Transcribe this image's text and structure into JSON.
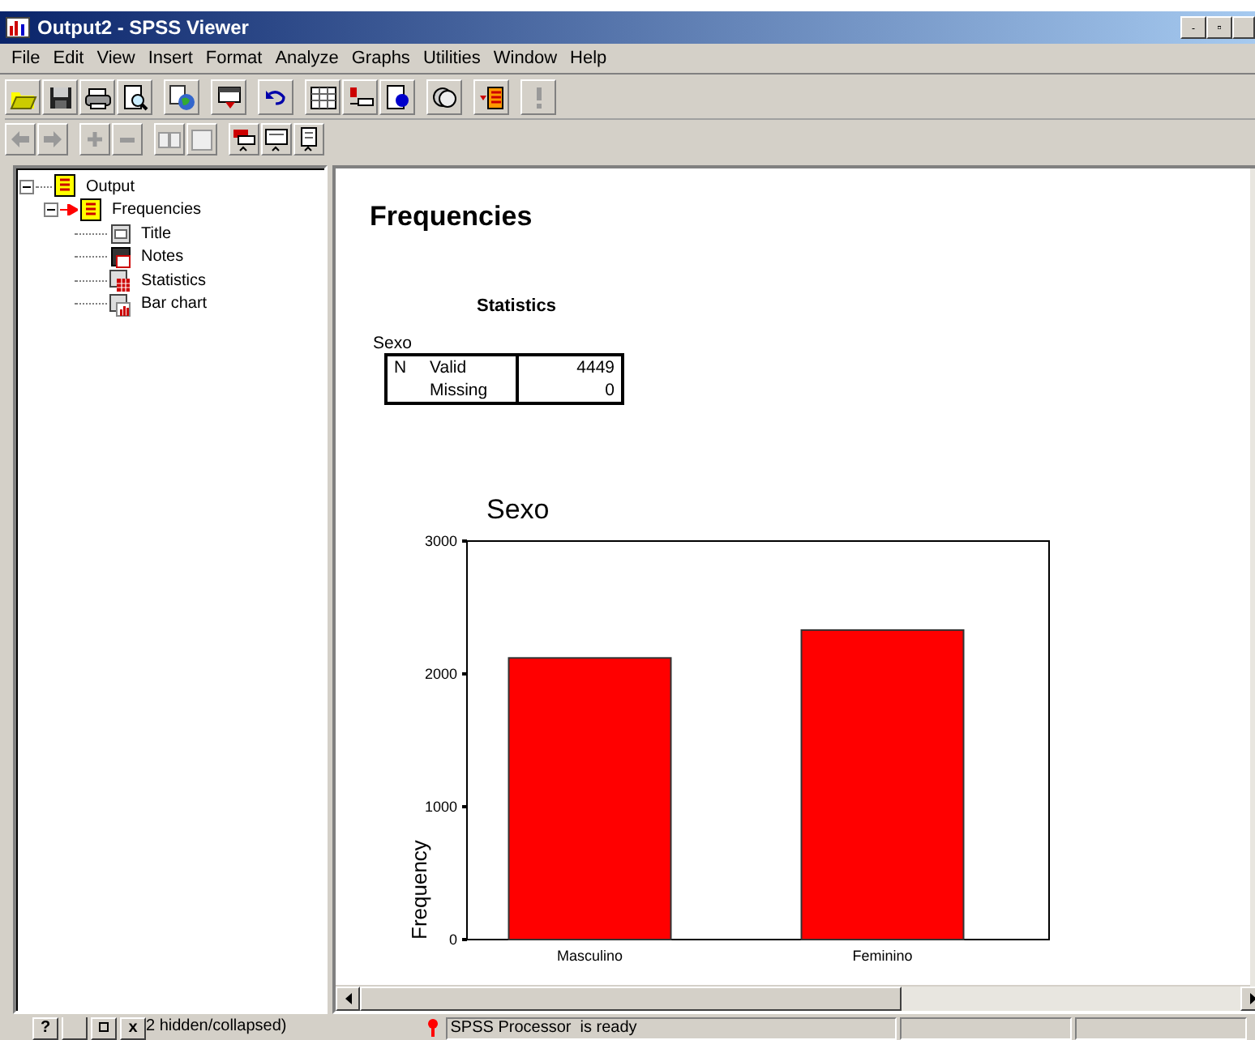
{
  "window": {
    "title": "Output2 - SPSS Viewer"
  },
  "menu": [
    "File",
    "Edit",
    "View",
    "Insert",
    "Format",
    "Analyze",
    "Graphs",
    "Utilities",
    "Window",
    "Help"
  ],
  "outline": {
    "items": [
      {
        "label": "Output",
        "kind": "folder",
        "expanded": true,
        "selected": false,
        "children": [
          {
            "label": "Frequencies",
            "kind": "folder",
            "expanded": true,
            "selected": true,
            "children": [
              {
                "label": "Title",
                "kind": "title",
                "selected": false
              },
              {
                "label": "Notes",
                "kind": "notes",
                "selected": false
              },
              {
                "label": "Statistics",
                "kind": "table",
                "selected": false
              },
              {
                "label": "Bar chart",
                "kind": "chart",
                "selected": false
              }
            ]
          }
        ]
      }
    ]
  },
  "output": {
    "heading": "Frequencies",
    "statistics": {
      "title": "Statistics",
      "variable": "Sexo",
      "rows": [
        {
          "group": "N",
          "label": "Valid",
          "value": "4449"
        },
        {
          "label": "Missing",
          "value": "0"
        }
      ]
    },
    "chart_data": {
      "type": "bar",
      "title": "Sexo",
      "ylabel": "Frequency",
      "categories": [
        "Masculino",
        "Feminino"
      ],
      "values": [
        2120,
        2330
      ],
      "ylim": [
        0,
        3000
      ],
      "yticks": [
        0,
        1000,
        2000,
        3000
      ]
    }
  },
  "status_bar": {
    "help_button": "?",
    "close_button": "x",
    "hidden_text": "2 hidden/collapsed)",
    "message": "SPSS Processor  is ready"
  }
}
